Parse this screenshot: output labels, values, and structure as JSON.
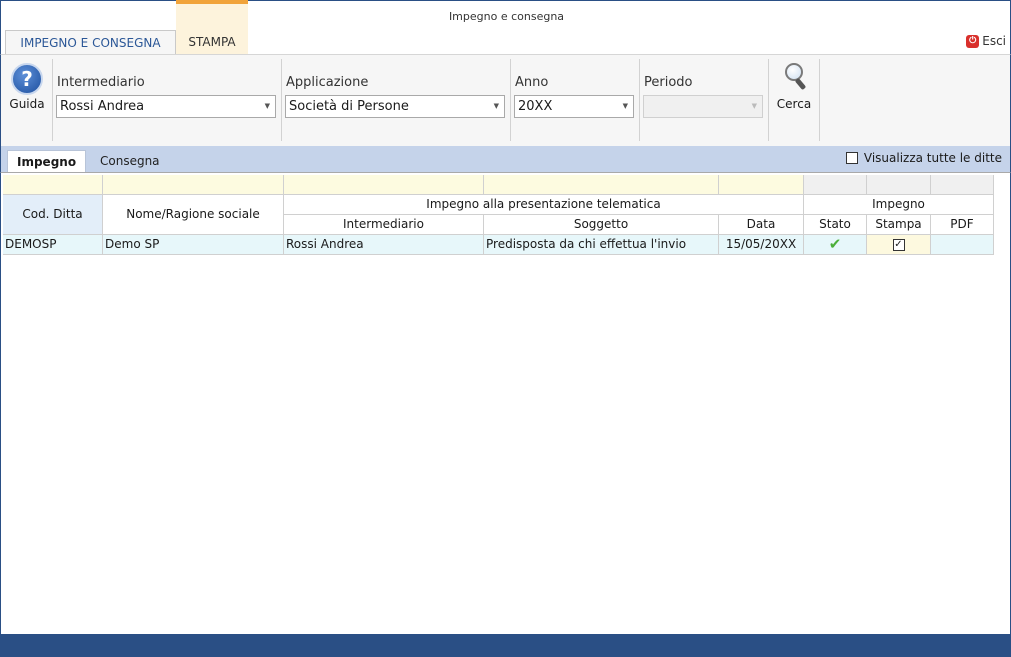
{
  "window": {
    "title": "Impegno e consegna"
  },
  "ribbon_tabs": [
    {
      "label": "IMPEGNO E CONSEGNA"
    },
    {
      "label": "STAMPA"
    }
  ],
  "exit": {
    "label": "Esci"
  },
  "toolbar": {
    "help_label": "Guida",
    "search_label": "Cerca",
    "intermediario": {
      "label": "Intermediario",
      "value": "Rossi Andrea"
    },
    "applicazione": {
      "label": "Applicazione",
      "value": "Società di Persone"
    },
    "anno": {
      "label": "Anno",
      "value": "20XX"
    },
    "periodo": {
      "label": "Periodo",
      "value": ""
    }
  },
  "subtabs": [
    {
      "label": "Impegno"
    },
    {
      "label": "Consegna"
    }
  ],
  "show_all": {
    "label": "Visualizza tutte le ditte",
    "checked": false
  },
  "table": {
    "group_headers": {
      "impegno_telematico": "Impegno alla presentazione telematica",
      "impegno": "Impegno"
    },
    "columns": {
      "cod_ditta": "Cod. Ditta",
      "nome": "Nome/Ragione sociale",
      "intermediario": "Intermediario",
      "soggetto": "Soggetto",
      "data": "Data",
      "stato": "Stato",
      "stampa": "Stampa",
      "pdf": "PDF"
    },
    "rows": [
      {
        "cod_ditta": "DEMOSP",
        "nome": "Demo SP",
        "intermediario": "Rossi Andrea",
        "soggetto": "Predisposta da chi effettua l'invio",
        "data": "15/05/20XX",
        "stato_icon": "green-check-icon",
        "stampa_checked": true,
        "pdf": ""
      }
    ]
  }
}
